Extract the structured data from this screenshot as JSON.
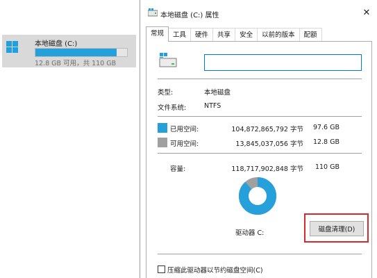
{
  "explorer": {
    "drive_name": "本地磁盘 (C:)",
    "drive_capacity_text": "12.8 GB 可用，共 110 GB",
    "drive_used_fraction": 0.884,
    "bar_color": "#26a0da"
  },
  "dialog": {
    "title": "本地磁盘 (C:) 属性",
    "close_glyph": "✕",
    "tabs": [
      "常规",
      "工具",
      "硬件",
      "共享",
      "安全",
      "以前的版本",
      "配额"
    ],
    "name_value": "",
    "type_label": "类型:",
    "type_value": "本地磁盘",
    "fs_label": "文件系统:",
    "fs_value": "NTFS",
    "used": {
      "label": "已用空间:",
      "bytes": "104,872,865,792 字节",
      "size": "97.6 GB",
      "color": "#26a0da"
    },
    "free": {
      "label": "可用空间:",
      "bytes": "13,845,037,056 字节",
      "size": "12.8 GB",
      "color": "#a0a0a0"
    },
    "capacity": {
      "label": "容量:",
      "bytes": "118,717,902,848 字节",
      "size": "110 GB"
    },
    "used_fraction": 0.884,
    "drive_label": "驱动器 C:",
    "cleanup_button": "磁盘清理(D)",
    "compress_checkbox": "压缩此驱动器以节约磁盘空间(C)",
    "icons": [
      "windows-drive-icon",
      "close-icon",
      "pie-chart"
    ]
  }
}
